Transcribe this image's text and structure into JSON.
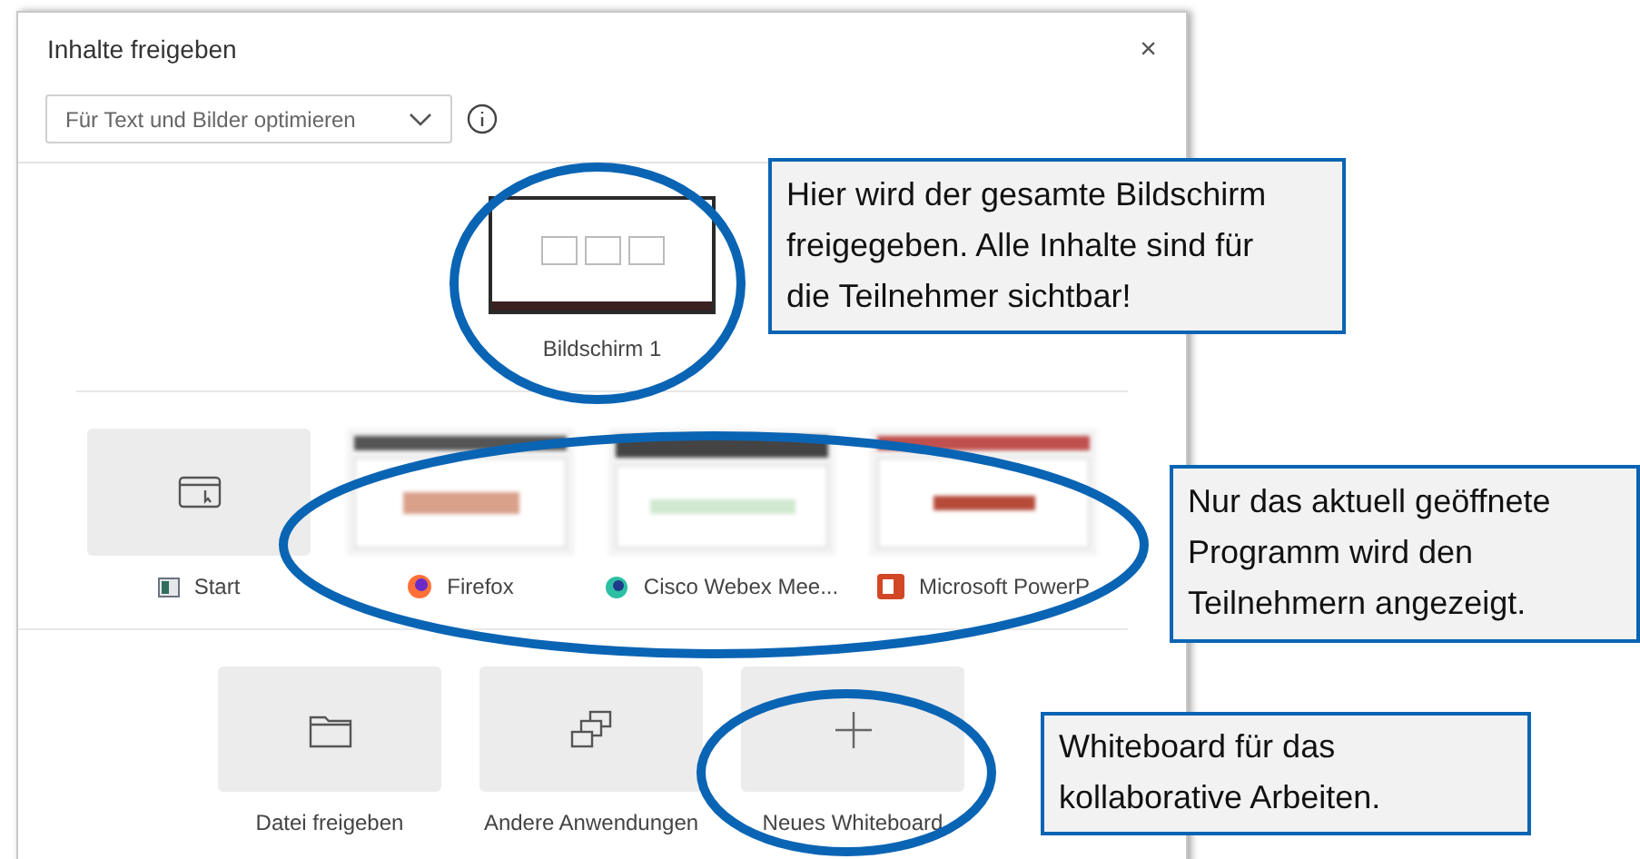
{
  "dialog": {
    "title": "Inhalte freigeben",
    "close": "×",
    "quality_dropdown": {
      "value": "Für Text und Bilder optimieren"
    }
  },
  "screens": [
    {
      "label": "Bildschirm 1"
    }
  ],
  "windows": [
    {
      "kind": "tile",
      "label": "Start"
    },
    {
      "kind": "thumbnail",
      "label": "Firefox"
    },
    {
      "kind": "thumbnail",
      "label": "Cisco Webex Mee..."
    },
    {
      "kind": "thumbnail",
      "label": "Microsoft PowerP"
    }
  ],
  "actions": [
    {
      "label": "Datei freigeben"
    },
    {
      "label": "Andere Anwendungen"
    },
    {
      "label": "Neues Whiteboard"
    }
  ],
  "callouts": [
    {
      "text": "Hier wird der gesamte Bildschirm freigegeben. Alle Inhalte sind für die Teilnehmer sichtbar!"
    },
    {
      "text": "Nur das aktuell geöffnete Programm wird den Teilnehmern angezeigt."
    },
    {
      "text": "Whiteboard für das kollaborative Arbeiten."
    }
  ]
}
